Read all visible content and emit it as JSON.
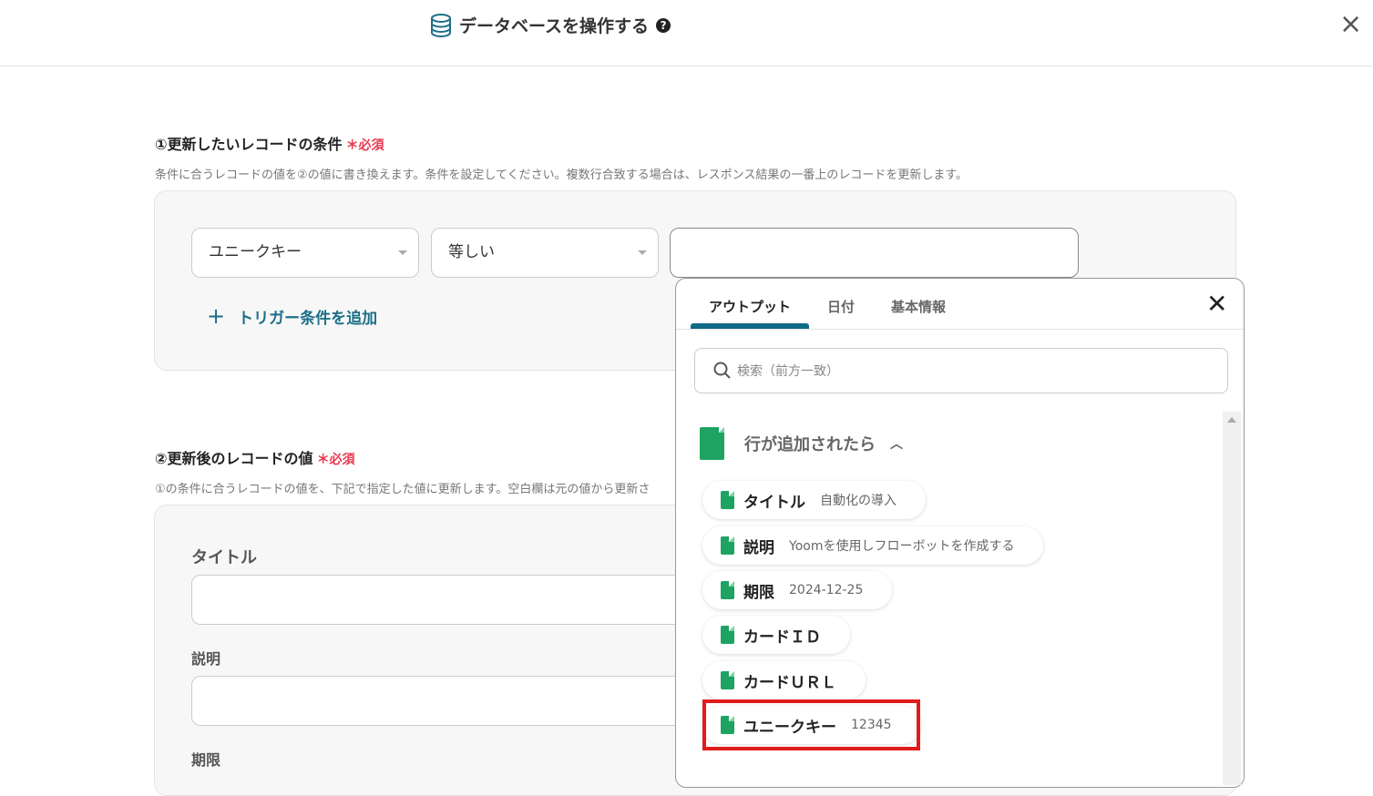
{
  "header": {
    "title": "データベースを操作する",
    "help": "?",
    "close": "×"
  },
  "section1": {
    "title": "①更新したいレコードの条件",
    "required": "＊必須",
    "description": "条件に合うレコードの値を②の値に書き換えます。条件を設定してください。複数行合致する場合は、レスポンス結果の一番上のレコードを更新します。",
    "field_select": "ユニークキー",
    "operator_select": "等しい",
    "value": "",
    "add_condition": "トリガー条件を追加"
  },
  "section2": {
    "title": "②更新後のレコードの値",
    "required": "＊必須",
    "description": "①の条件に合うレコードの値を、下記で指定した値に更新します。空白欄は元の値から更新さ",
    "fields": [
      {
        "label": "タイトル"
      },
      {
        "label": "説明"
      },
      {
        "label": "期限"
      }
    ]
  },
  "popup": {
    "tabs": [
      "アウトプット",
      "日付",
      "基本情報"
    ],
    "search_placeholder": "検索（前方一致）",
    "group": "行が追加されたら",
    "items": [
      {
        "key": "タイトル",
        "value": "自動化の導入"
      },
      {
        "key": "説明",
        "value": "Yoomを使用しフローボットを作成する"
      },
      {
        "key": "期限",
        "value": "2024-12-25"
      },
      {
        "key": "カードＩＤ",
        "value": ""
      },
      {
        "key": "カードＵＲＬ",
        "value": ""
      },
      {
        "key": "ユニークキー",
        "value": "12345"
      }
    ]
  }
}
